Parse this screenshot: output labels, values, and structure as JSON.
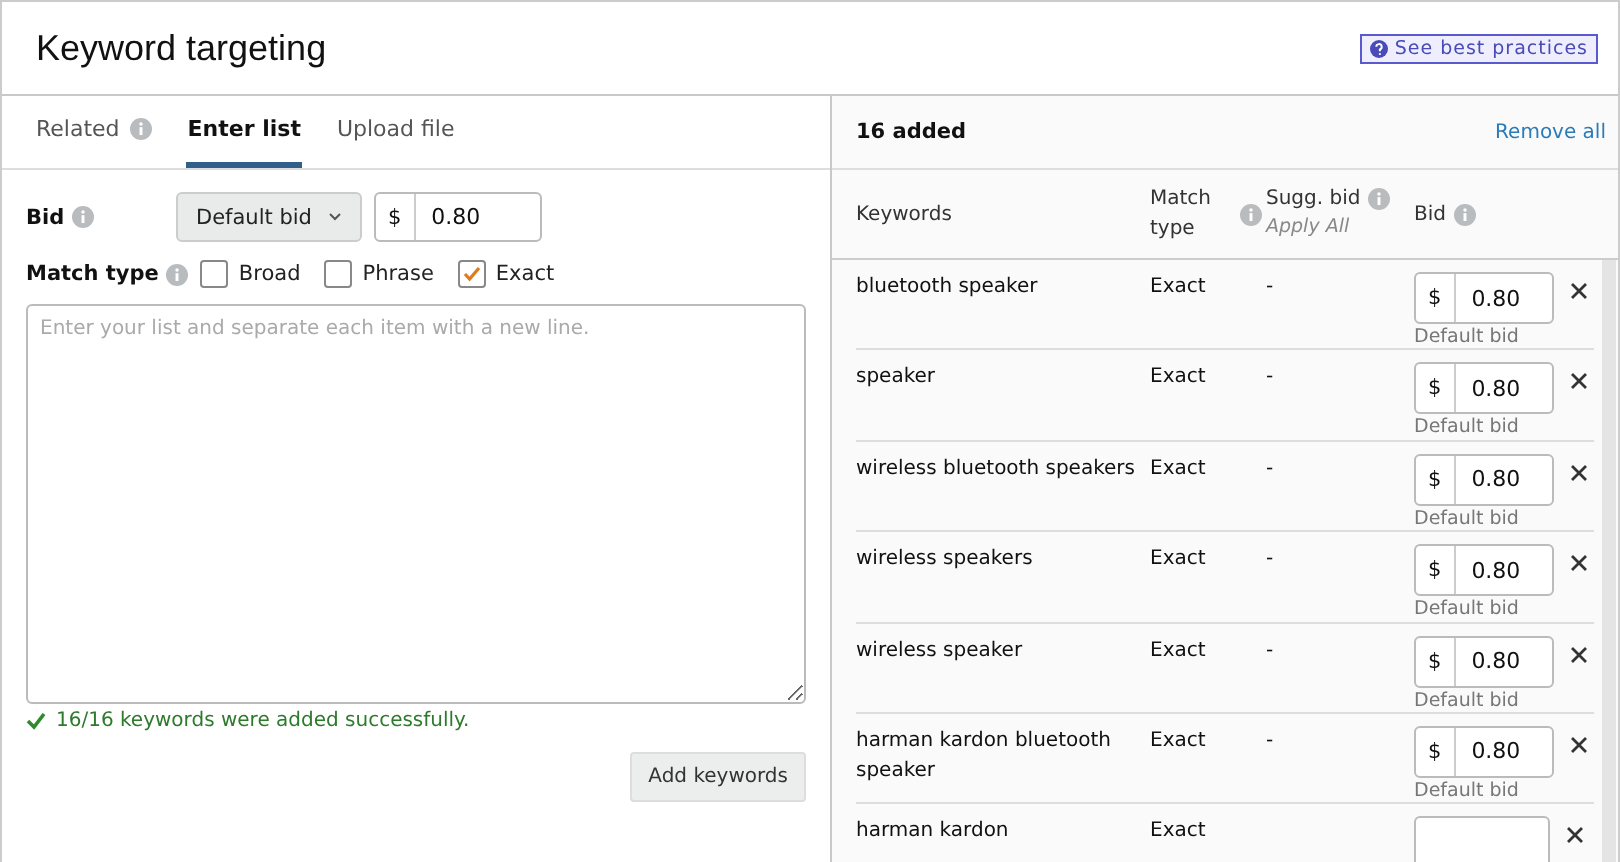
{
  "title": "Keyword targeting",
  "best_practices_link": "See best practices",
  "tabs": [
    {
      "label": "Related",
      "info": true,
      "selected": false
    },
    {
      "label": "Enter list",
      "info": false,
      "selected": true
    },
    {
      "label": "Upload file",
      "info": false,
      "selected": false
    }
  ],
  "bid": {
    "label": "Bid",
    "dropdown": "Default bid",
    "currency": "$",
    "value": "0.80"
  },
  "match_type": {
    "label": "Match type",
    "options": [
      {
        "label": "Broad",
        "checked": false
      },
      {
        "label": "Phrase",
        "checked": false
      },
      {
        "label": "Exact",
        "checked": true
      }
    ]
  },
  "list_input": {
    "placeholder": "Enter your list and separate each item with a new line."
  },
  "success_message": "16/16 keywords were added successfully.",
  "add_button": "Add keywords",
  "added": {
    "count_label": "16 added",
    "remove_all": "Remove all",
    "columns": [
      {
        "label": "Keywords"
      },
      {
        "label": "Match type",
        "info": true
      },
      {
        "label": "Sugg. bid",
        "info": true,
        "sub": "Apply All"
      },
      {
        "label": "Bid",
        "info": true
      }
    ],
    "rows": [
      {
        "keyword": "bluetooth speaker",
        "match": "Exact",
        "sugg": "-",
        "currency": "$",
        "bid": "0.80",
        "note": "Default bid"
      },
      {
        "keyword": "speaker",
        "match": "Exact",
        "sugg": "-",
        "currency": "$",
        "bid": "0.80",
        "note": "Default bid"
      },
      {
        "keyword": "wireless bluetooth speakers",
        "match": "Exact",
        "sugg": "-",
        "currency": "$",
        "bid": "0.80",
        "note": "Default bid"
      },
      {
        "keyword": "wireless speakers",
        "match": "Exact",
        "sugg": "-",
        "currency": "$",
        "bid": "0.80",
        "note": "Default bid"
      },
      {
        "keyword": "wireless speaker",
        "match": "Exact",
        "sugg": "-",
        "currency": "$",
        "bid": "0.80",
        "note": "Default bid"
      },
      {
        "keyword": "harman kardon bluetooth speaker",
        "match": "Exact",
        "sugg": "-",
        "currency": "$",
        "bid": "0.80",
        "note": "Default bid"
      },
      {
        "keyword": "harman kardon",
        "match": "Exact"
      }
    ]
  }
}
